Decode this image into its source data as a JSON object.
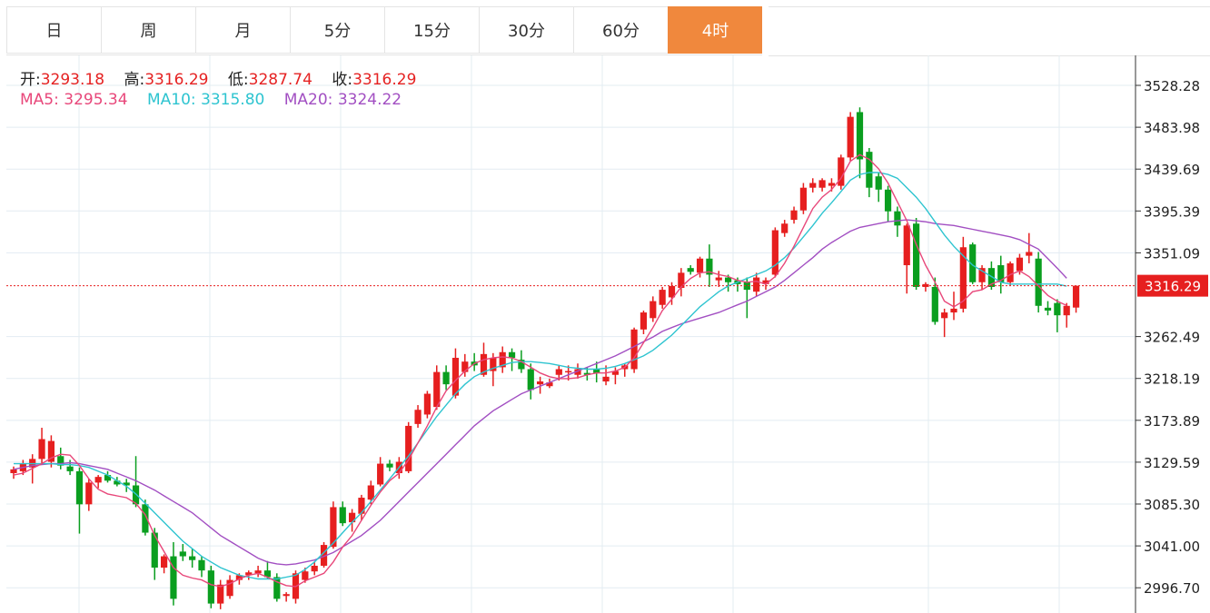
{
  "tabs": [
    {
      "label": "日"
    },
    {
      "label": "周"
    },
    {
      "label": "月"
    },
    {
      "label": "5分"
    },
    {
      "label": "15分"
    },
    {
      "label": "30分"
    },
    {
      "label": "60分"
    },
    {
      "label": "4时",
      "active": true
    }
  ],
  "ohlc": {
    "open_label": "开:",
    "open": "3293.18",
    "high_label": "高:",
    "high": "3316.29",
    "low_label": "低:",
    "low": "3287.74",
    "close_label": "收:",
    "close": "3316.29"
  },
  "ma": {
    "ma5_label": "MA5:",
    "ma5": "3295.34",
    "ma10_label": "MA10:",
    "ma10": "3315.80",
    "ma20_label": "MA20:",
    "ma20": "3324.22"
  },
  "colors": {
    "up": "#e61f1f",
    "down": "#0a9e1f",
    "ma5": "#e8477a",
    "ma10": "#2ec4d0",
    "ma20": "#a24fc2",
    "accent": "#f0883d",
    "grid": "#e3ecf2"
  },
  "chart_data": {
    "type": "candlestick",
    "ylim": [
      2970,
      3560
    ],
    "y_ticks": [
      "3528.28",
      "3483.98",
      "3439.69",
      "3395.39",
      "3351.09",
      "3262.49",
      "3218.19",
      "3173.89",
      "3129.59",
      "3085.30",
      "3041.00",
      "2996.70"
    ],
    "last_price": "3316.29",
    "candles": [
      [
        3118,
        3125,
        3112,
        3122
      ],
      [
        3120,
        3132,
        3116,
        3128
      ],
      [
        3124,
        3138,
        3107,
        3133
      ],
      [
        3133,
        3166,
        3128,
        3154
      ],
      [
        3130,
        3158,
        3124,
        3152
      ],
      [
        3136,
        3145,
        3122,
        3126
      ],
      [
        3125,
        3132,
        3116,
        3120
      ],
      [
        3120,
        3124,
        3054,
        3085
      ],
      [
        3085,
        3112,
        3078,
        3108
      ],
      [
        3108,
        3116,
        3102,
        3114
      ],
      [
        3116,
        3120,
        3108,
        3110
      ],
      [
        3110,
        3114,
        3104,
        3106
      ],
      [
        3108,
        3112,
        3098,
        3105
      ],
      [
        3105,
        3136,
        3082,
        3085
      ],
      [
        3085,
        3090,
        3052,
        3055
      ],
      [
        3055,
        3060,
        3005,
        3018
      ],
      [
        3018,
        3032,
        3012,
        3030
      ],
      [
        3030,
        3045,
        2978,
        2985
      ],
      [
        3035,
        3043,
        3025,
        3030
      ],
      [
        3030,
        3038,
        3018,
        3026
      ],
      [
        3026,
        3030,
        3008,
        3015
      ],
      [
        3015,
        3020,
        2975,
        2980
      ],
      [
        2980,
        3005,
        2974,
        3000
      ],
      [
        2988,
        3010,
        2985,
        3005
      ],
      [
        3005,
        3012,
        3000,
        3010
      ],
      [
        3010,
        3015,
        3005,
        3013
      ],
      [
        3012,
        3020,
        3008,
        3015
      ],
      [
        3015,
        3025,
        3006,
        3008
      ],
      [
        3008,
        3012,
        2982,
        2985
      ],
      [
        2988,
        2992,
        2982,
        2990
      ],
      [
        2985,
        3015,
        2980,
        3012
      ],
      [
        3005,
        3018,
        3002,
        3014
      ],
      [
        3014,
        3024,
        3010,
        3020
      ],
      [
        3020,
        3045,
        3018,
        3042
      ],
      [
        3040,
        3088,
        3038,
        3082
      ],
      [
        3082,
        3088,
        3062,
        3065
      ],
      [
        3066,
        3080,
        3056,
        3076
      ],
      [
        3075,
        3095,
        3068,
        3092
      ],
      [
        3090,
        3110,
        3085,
        3105
      ],
      [
        3106,
        3135,
        3104,
        3128
      ],
      [
        3128,
        3132,
        3120,
        3124
      ],
      [
        3118,
        3135,
        3112,
        3130
      ],
      [
        3120,
        3172,
        3118,
        3168
      ],
      [
        3170,
        3190,
        3166,
        3185
      ],
      [
        3180,
        3205,
        3176,
        3202
      ],
      [
        3188,
        3232,
        3185,
        3225
      ],
      [
        3225,
        3232,
        3206,
        3212
      ],
      [
        3200,
        3250,
        3197,
        3240
      ],
      [
        3225,
        3244,
        3220,
        3236
      ],
      [
        3236,
        3245,
        3226,
        3232
      ],
      [
        3222,
        3256,
        3220,
        3244
      ],
      [
        3226,
        3245,
        3210,
        3240
      ],
      [
        3230,
        3252,
        3224,
        3246
      ],
      [
        3246,
        3250,
        3226,
        3240
      ],
      [
        3238,
        3248,
        3224,
        3228
      ],
      [
        3228,
        3234,
        3196,
        3206
      ],
      [
        3212,
        3220,
        3202,
        3215
      ],
      [
        3210,
        3218,
        3208,
        3214
      ],
      [
        3222,
        3232,
        3216,
        3228
      ],
      [
        3225,
        3232,
        3216,
        3226
      ],
      [
        3222,
        3234,
        3218,
        3228
      ],
      [
        3224,
        3230,
        3216,
        3222
      ],
      [
        3228,
        3236,
        3214,
        3224
      ],
      [
        3215,
        3232,
        3211,
        3220
      ],
      [
        3222,
        3230,
        3212,
        3226
      ],
      [
        3228,
        3234,
        3220,
        3232
      ],
      [
        3228,
        3272,
        3224,
        3270
      ],
      [
        3270,
        3290,
        3265,
        3288
      ],
      [
        3282,
        3305,
        3278,
        3300
      ],
      [
        3296,
        3315,
        3292,
        3312
      ],
      [
        3304,
        3320,
        3296,
        3316
      ],
      [
        3314,
        3335,
        3305,
        3330
      ],
      [
        3335,
        3338,
        3328,
        3331
      ],
      [
        3330,
        3347,
        3325,
        3345
      ],
      [
        3345,
        3360,
        3315,
        3328
      ],
      [
        3322,
        3332,
        3315,
        3325
      ],
      [
        3325,
        3328,
        3310,
        3320
      ],
      [
        3322,
        3325,
        3310,
        3318
      ],
      [
        3320,
        3325,
        3282,
        3312
      ],
      [
        3310,
        3330,
        3305,
        3325
      ],
      [
        3318,
        3325,
        3312,
        3322
      ],
      [
        3328,
        3378,
        3325,
        3375
      ],
      [
        3372,
        3386,
        3368,
        3382
      ],
      [
        3386,
        3400,
        3382,
        3396
      ],
      [
        3396,
        3425,
        3392,
        3420
      ],
      [
        3420,
        3430,
        3415,
        3425
      ],
      [
        3420,
        3430,
        3416,
        3428
      ],
      [
        3422,
        3430,
        3416,
        3425
      ],
      [
        3422,
        3455,
        3418,
        3452
      ],
      [
        3452,
        3500,
        3448,
        3495
      ],
      [
        3500,
        3505,
        3430,
        3450
      ],
      [
        3458,
        3462,
        3410,
        3420
      ],
      [
        3432,
        3436,
        3405,
        3418
      ],
      [
        3418,
        3422,
        3384,
        3395
      ],
      [
        3395,
        3400,
        3368,
        3380
      ],
      [
        3338,
        3382,
        3308,
        3380
      ],
      [
        3382,
        3388,
        3312,
        3315
      ],
      [
        3315,
        3320,
        3310,
        3318
      ],
      [
        3315,
        3325,
        3275,
        3278
      ],
      [
        3282,
        3292,
        3262,
        3288
      ],
      [
        3288,
        3310,
        3280,
        3292
      ],
      [
        3292,
        3368,
        3288,
        3357
      ],
      [
        3360,
        3362,
        3318,
        3320
      ],
      [
        3320,
        3338,
        3312,
        3335
      ],
      [
        3335,
        3342,
        3312,
        3315
      ],
      [
        3338,
        3348,
        3308,
        3320
      ],
      [
        3320,
        3342,
        3316,
        3340
      ],
      [
        3332,
        3350,
        3328,
        3346
      ],
      [
        3348,
        3372,
        3340,
        3352
      ],
      [
        3345,
        3352,
        3288,
        3295
      ],
      [
        3293,
        3300,
        3285,
        3290
      ],
      [
        3298,
        3302,
        3267,
        3285
      ],
      [
        3285,
        3298,
        3272,
        3295
      ],
      [
        3293.18,
        3316.29,
        3287.74,
        3316.29
      ]
    ],
    "ma5": [
      3116,
      3118,
      3123,
      3128,
      3134,
      3138,
      3137,
      3126,
      3112,
      3101,
      3096,
      3094,
      3092,
      3086,
      3074,
      3052,
      3035,
      3018,
      3010,
      3007,
      3005,
      3000,
      2998,
      3001,
      3006,
      3010,
      3012,
      3008,
      3003,
      2999,
      2998,
      3004,
      3008,
      3012,
      3024,
      3040,
      3052,
      3068,
      3084,
      3098,
      3110,
      3118,
      3132,
      3150,
      3168,
      3188,
      3205,
      3216,
      3226,
      3234,
      3238,
      3240,
      3241,
      3240,
      3236,
      3230,
      3224,
      3220,
      3218,
      3218,
      3219,
      3222,
      3224,
      3224,
      3226,
      3230,
      3240,
      3256,
      3272,
      3290,
      3302,
      3315,
      3324,
      3330,
      3331,
      3328,
      3326,
      3322,
      3320,
      3321,
      3318,
      3326,
      3340,
      3358,
      3378,
      3398,
      3410,
      3418,
      3430,
      3448,
      3455,
      3450,
      3440,
      3425,
      3405,
      3385,
      3360,
      3338,
      3320,
      3300,
      3294,
      3300,
      3310,
      3312,
      3318,
      3322,
      3328,
      3332,
      3326,
      3316,
      3306,
      3300,
      3295.34
    ],
    "ma10": [
      3128,
      3128,
      3128,
      3128,
      3128,
      3127,
      3127,
      3126,
      3124,
      3120,
      3116,
      3110,
      3104,
      3096,
      3086,
      3076,
      3066,
      3056,
      3046,
      3038,
      3030,
      3024,
      3018,
      3014,
      3010,
      3008,
      3006,
      3006,
      3006,
      3008,
      3010,
      3016,
      3024,
      3034,
      3044,
      3055,
      3066,
      3076,
      3088,
      3100,
      3112,
      3124,
      3136,
      3150,
      3164,
      3178,
      3190,
      3202,
      3212,
      3220,
      3225,
      3229,
      3232,
      3235,
      3236,
      3236,
      3235,
      3234,
      3232,
      3230,
      3229,
      3228,
      3228,
      3229,
      3231,
      3234,
      3238,
      3242,
      3248,
      3256,
      3264,
      3274,
      3284,
      3294,
      3302,
      3310,
      3316,
      3320,
      3324,
      3328,
      3332,
      3338,
      3346,
      3356,
      3368,
      3380,
      3393,
      3404,
      3416,
      3428,
      3434,
      3436,
      3436,
      3434,
      3430,
      3420,
      3410,
      3398,
      3384,
      3370,
      3358,
      3348,
      3338,
      3332,
      3326,
      3320,
      3318,
      3318,
      3318,
      3318,
      3318,
      3318,
      3315.8
    ],
    "ma20": [
      3122,
      3124,
      3126,
      3127,
      3128,
      3128,
      3129,
      3128,
      3126,
      3124,
      3122,
      3118,
      3114,
      3110,
      3105,
      3100,
      3094,
      3088,
      3082,
      3076,
      3068,
      3060,
      3052,
      3046,
      3040,
      3034,
      3028,
      3024,
      3022,
      3021,
      3022,
      3024,
      3026,
      3030,
      3034,
      3040,
      3046,
      3052,
      3060,
      3068,
      3078,
      3088,
      3098,
      3108,
      3118,
      3128,
      3138,
      3148,
      3158,
      3168,
      3176,
      3184,
      3190,
      3196,
      3202,
      3206,
      3210,
      3214,
      3218,
      3222,
      3226,
      3230,
      3234,
      3238,
      3242,
      3247,
      3252,
      3257,
      3262,
      3268,
      3272,
      3276,
      3279,
      3282,
      3285,
      3288,
      3292,
      3296,
      3300,
      3305,
      3310,
      3315,
      3322,
      3330,
      3338,
      3346,
      3355,
      3362,
      3368,
      3374,
      3378,
      3380,
      3382,
      3384,
      3385,
      3386,
      3385,
      3384,
      3382,
      3381,
      3380,
      3378,
      3376,
      3374,
      3372,
      3370,
      3368,
      3365,
      3360,
      3355,
      3345,
      3335,
      3324.22
    ]
  }
}
